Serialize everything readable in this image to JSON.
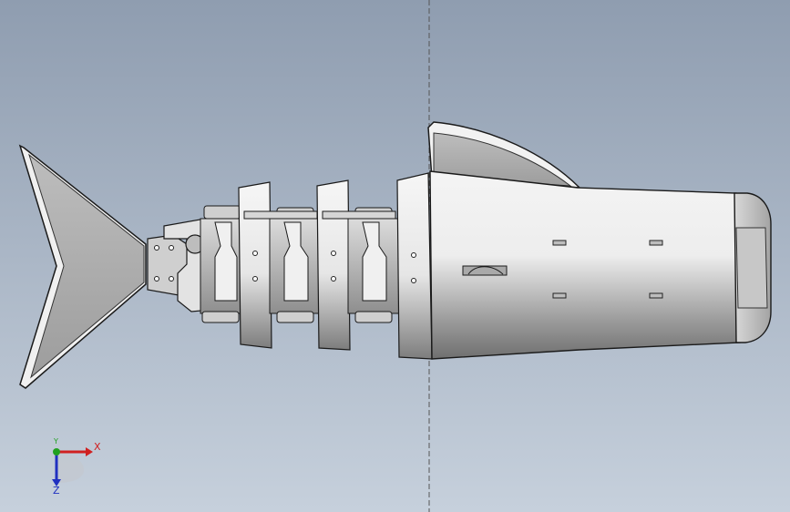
{
  "viewport": {
    "background_top": "#8f9db0",
    "background_bottom": "#c6d0dc"
  },
  "model": {
    "part_color": "#d9d9d9",
    "edge_color": "#1a1a1a"
  },
  "triad": {
    "x_label": "X",
    "y_label": "Y",
    "z_label": "Z",
    "x_color": "#d02020",
    "y_color": "#20a020",
    "z_color": "#2030c0"
  }
}
